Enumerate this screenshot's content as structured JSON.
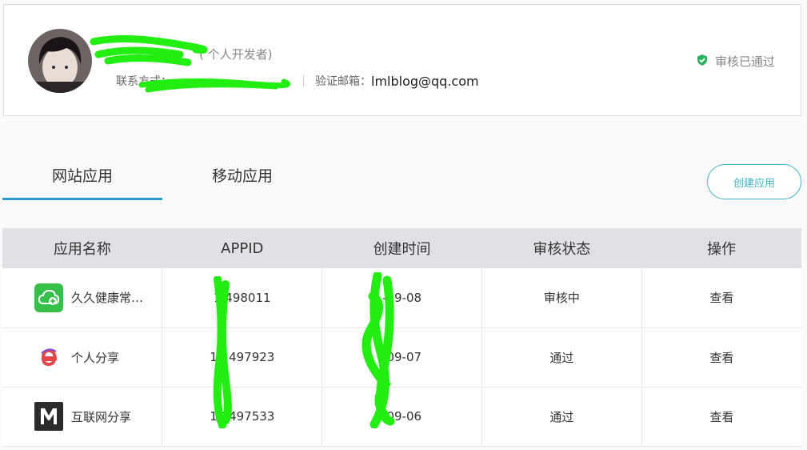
{
  "profile": {
    "name": "",
    "developer_type": "( 个人开发者)",
    "contact_label": "联系方式：",
    "contact_value": "",
    "email_label": "验证邮箱：",
    "email_value": "lmlblog@qq.com",
    "verified_text": "审核已通过"
  },
  "tabs": [
    {
      "label": "网站应用",
      "active": true
    },
    {
      "label": "移动应用",
      "active": false
    }
  ],
  "create_button": "创建应用",
  "table": {
    "headers": [
      "应用名称",
      "APPID",
      "创建时间",
      "审核状态",
      "操作"
    ],
    "rows": [
      {
        "app_name": "久久健康常…",
        "icon": "cloud-add-icon",
        "appid": "1  498011",
        "created": "    -09-08",
        "status": "审核中",
        "status_type": "pending",
        "action": "查看"
      },
      {
        "app_name": "个人分享",
        "icon": "e-logo-icon",
        "appid": "1 1497923",
        "created": "    -09-07",
        "status": "通过",
        "status_type": "pass",
        "action": "查看"
      },
      {
        "app_name": "互联网分享",
        "icon": "m-logo-icon",
        "appid": "1 1497533",
        "created": "    -09-06",
        "status": "通过",
        "status_type": "pass",
        "action": "查看"
      }
    ]
  },
  "colors": {
    "accent": "#2c9ad6",
    "pending": "#ee7b48",
    "pass": "#2ab15f",
    "link": "#2a8fc8",
    "redaction": "#22ee11"
  }
}
